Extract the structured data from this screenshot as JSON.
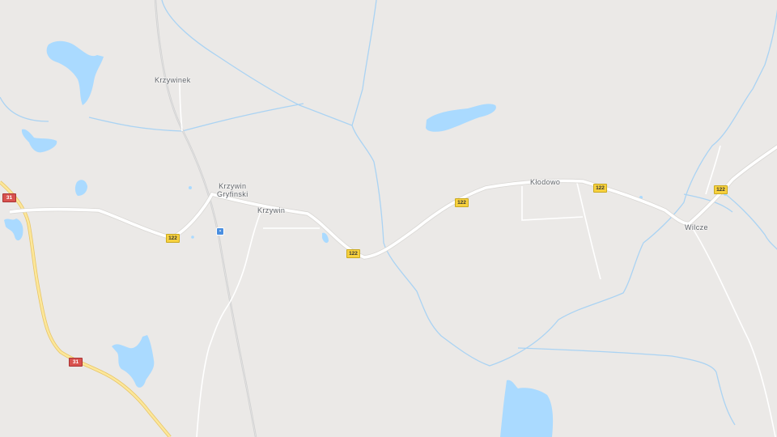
{
  "map": {
    "places": {
      "krzywinek": "Krzywinek",
      "krzywin_gryfinski": "Krzywin\nGryfinski",
      "krzywin": "Krzywin",
      "klodowo": "Kłodowo",
      "wilcze": "Wilcze"
    },
    "shields": {
      "r122_a": "122",
      "r122_b": "122",
      "r122_c": "122",
      "r122_d": "122",
      "r122_e": "122",
      "r31_a": "31",
      "r31_b": "31"
    },
    "colors": {
      "land": "#ebe9e7",
      "water": "#aadaff",
      "road": "#ffffff",
      "highway": "#f9e08b",
      "rail": "#c7c7c7"
    },
    "icons": {
      "transit_stop": "train-stop-icon"
    }
  }
}
